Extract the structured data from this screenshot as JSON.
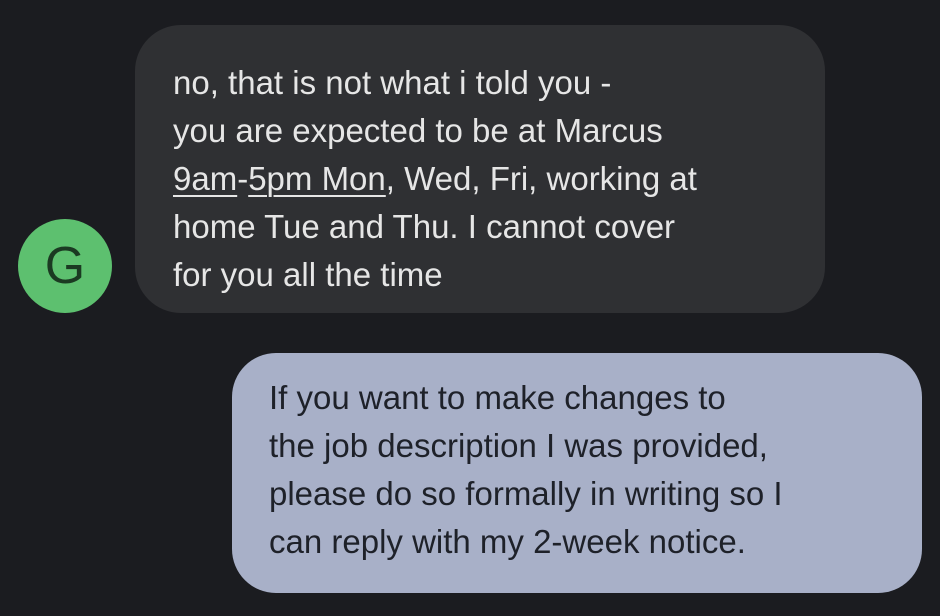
{
  "contact": {
    "avatar_initial": "G",
    "avatar_color": "#5dc06f"
  },
  "incoming_message": {
    "line1": "no, that is not what i told you -",
    "line2": "you are expected to be at Marcus",
    "line3_link1": "9am",
    "line3_sep": "-",
    "line3_link2": "5pm Mon",
    "line3_rest": ", Wed, Fri, working at",
    "line4": "home Tue and Thu. I cannot cover",
    "line5": "for you all the time",
    "bubble_color": "#2f3033"
  },
  "outgoing_message": {
    "line1": "If you want to make changes to",
    "line2": "the job description I was provided,",
    "line3": "please do so formally in writing so I",
    "line4": "can reply with my 2-week notice.",
    "bubble_color": "#a8b0c8"
  }
}
